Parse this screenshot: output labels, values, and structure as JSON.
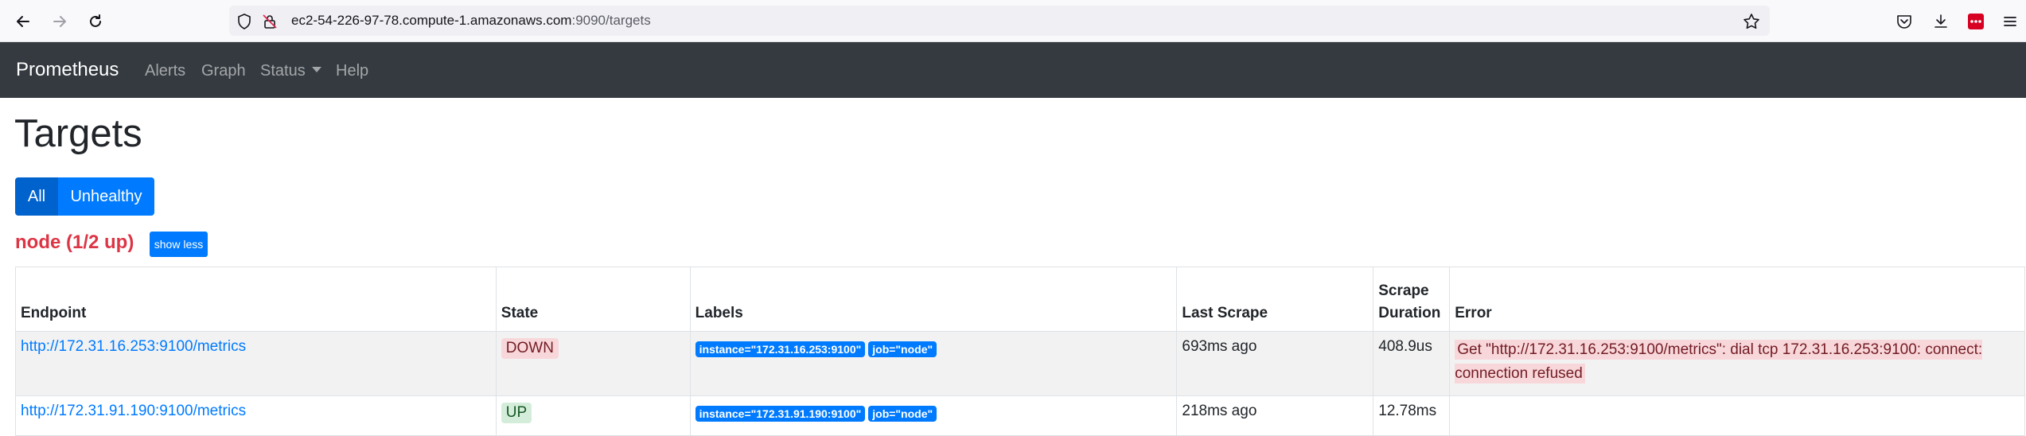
{
  "browser": {
    "url_host": "ec2-54-226-97-78.compute-1.amazonaws.com",
    "url_rest": ":9090/targets"
  },
  "navbar": {
    "brand": "Prometheus",
    "links": [
      "Alerts",
      "Graph",
      "Status",
      "Help"
    ]
  },
  "page": {
    "title": "Targets",
    "filters": {
      "all": "All",
      "unhealthy": "Unhealthy"
    }
  },
  "job": {
    "heading": "node (1/2 up)",
    "toggle_label": "show less"
  },
  "table": {
    "headers": {
      "endpoint": "Endpoint",
      "state": "State",
      "labels": "Labels",
      "last_scrape": "Last Scrape",
      "scrape_duration": "Scrape Duration",
      "error": "Error"
    },
    "rows": [
      {
        "endpoint": "http://172.31.16.253:9100/metrics",
        "state": "DOWN",
        "label_instance": "instance=\"172.31.16.253:9100\"",
        "label_job": "job=\"node\"",
        "last_scrape": "693ms ago",
        "scrape_duration": "408.9us",
        "error": "Get \"http://172.31.16.253:9100/metrics\": dial tcp 172.31.16.253:9100: connect: connection refused"
      },
      {
        "endpoint": "http://172.31.91.190:9100/metrics",
        "state": "UP",
        "label_instance": "instance=\"172.31.91.190:9100\"",
        "label_job": "job=\"node\"",
        "last_scrape": "218ms ago",
        "scrape_duration": "12.78ms",
        "error": ""
      }
    ]
  },
  "icons": {
    "back": "arrow-left-icon",
    "forward": "arrow-right-icon",
    "reload": "reload-icon",
    "shield": "shield-icon",
    "lock": "insecure-lock-icon",
    "bookmark": "star-icon",
    "pocket": "pocket-icon",
    "downloads": "download-icon",
    "extension": "extension-icon",
    "menu": "hamburger-menu-icon"
  },
  "colors": {
    "navbar_bg": "#343a40",
    "primary": "#007bff",
    "danger": "#dc3545",
    "down_bg": "#f8d7da",
    "up_bg": "#d4edda"
  }
}
